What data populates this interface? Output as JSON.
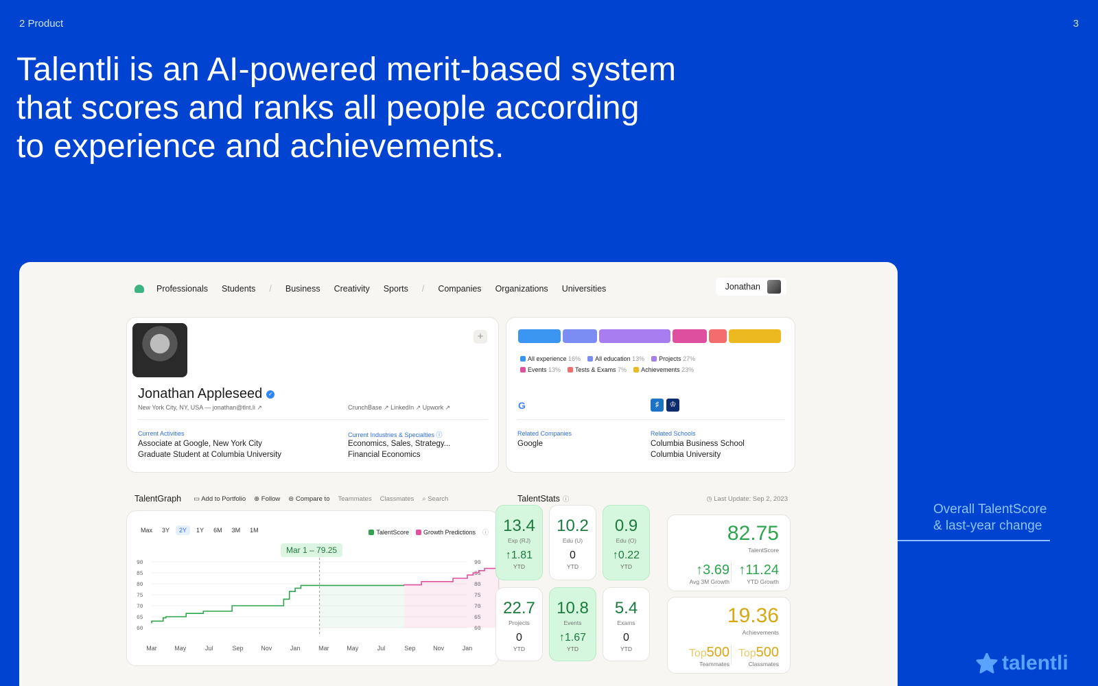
{
  "slide": {
    "section": "2 Product",
    "page_number": "3",
    "headline_lines": [
      "Talentli is an AI-powered merit-based system",
      "that scores and ranks all people according",
      "to experience and achievements."
    ],
    "annotation_lines": [
      "Overall TalentScore",
      "& last-year change"
    ],
    "logo_text": "talentli"
  },
  "nav": {
    "items_group1": [
      "Professionals",
      "Students"
    ],
    "items_group2": [
      "Business",
      "Creativity",
      "Sports"
    ],
    "items_group3": [
      "Companies",
      "Organizations",
      "Universities"
    ],
    "separator": "/",
    "user_name": "Jonathan"
  },
  "profile": {
    "name": "Jonathan Appleseed",
    "location": "New York City, NY, USA  —  jonathan@tlnt.li ↗",
    "links": "CrunchBase ↗  LinkedIn ↗  Upwork ↗",
    "plus": "+",
    "activities_label": "Current Activities",
    "activities": [
      "Associate at Google, New York City",
      "Graduate Student at Columbia University"
    ],
    "industries_label": "Current Industries & Specialties ⓘ",
    "industries": [
      "Economics, Sales, Strategy...",
      "Financial Economics"
    ]
  },
  "distribution": {
    "segments": [
      {
        "label": "All experience",
        "pct": "16%",
        "color": "#3a96f0",
        "share": 16
      },
      {
        "label": "All education",
        "pct": "13%",
        "color": "#7b8cf2",
        "share": 13
      },
      {
        "label": "Projects",
        "pct": "27%",
        "color": "#a77df0",
        "share": 27
      },
      {
        "label": "Events",
        "pct": "13%",
        "color": "#df4fa0",
        "share": 13
      },
      {
        "label": "Tests & Exams",
        "pct": "7%",
        "color": "#f46d6d",
        "share": 7
      },
      {
        "label": "Achievements",
        "pct": "23%",
        "color": "#ecb920",
        "share": 23
      }
    ],
    "companies_label": "Related Companies",
    "companies": [
      "Google"
    ],
    "schools_label": "Related Schools",
    "schools": [
      "Columbia Business School",
      "Columbia University"
    ]
  },
  "graph_toolbar": {
    "title": "TalentGraph",
    "add_to_portfolio": "Add to Portfolio",
    "follow": "Follow",
    "compare_to": "Compare to",
    "teammates": "Teammates",
    "classmates": "Classmates",
    "search": "Search"
  },
  "stats_toolbar": {
    "title": "TalentStats",
    "last_update": "Last Update: Sep 2, 2023"
  },
  "graph": {
    "ranges": [
      "Max",
      "3Y",
      "2Y",
      "1Y",
      "6M",
      "3M",
      "1M"
    ],
    "active_range": "2Y",
    "legend_talentscore": "TalentScore",
    "legend_growth": "Growth Predictions",
    "tooltip": "Mar 1 – 79.25"
  },
  "chart_data": {
    "type": "line",
    "x_labels": [
      "Mar",
      "May",
      "Jul",
      "Sep",
      "Nov",
      "Jan",
      "Mar",
      "May",
      "Jul",
      "Sep",
      "Nov",
      "Jan"
    ],
    "ylim": [
      60,
      90
    ],
    "y_ticks": [
      90,
      85,
      80,
      75,
      70,
      65,
      60
    ],
    "series": [
      {
        "name": "TalentScore",
        "color": "#2ea44f",
        "points": [
          [
            0,
            62
          ],
          [
            0.4,
            63
          ],
          [
            0.5,
            64.5
          ],
          [
            1.2,
            65
          ],
          [
            1.8,
            66.5
          ],
          [
            2.8,
            67.5
          ],
          [
            4.6,
            70
          ],
          [
            4.8,
            73
          ],
          [
            5.0,
            76.5
          ],
          [
            5.2,
            78
          ],
          [
            5.8,
            79.25
          ],
          [
            8.8,
            79.25
          ]
        ]
      },
      {
        "name": "Growth Predictions",
        "color": "#e0529c",
        "points": [
          [
            8.8,
            79.25
          ],
          [
            9.4,
            79.5
          ],
          [
            10.5,
            81
          ],
          [
            11.0,
            82.5
          ],
          [
            11.2,
            84
          ],
          [
            11.4,
            85
          ],
          [
            11.6,
            86
          ],
          [
            11.8,
            87
          ],
          [
            12.3,
            87
          ]
        ]
      }
    ],
    "marker_x": 5.85
  },
  "stats": {
    "cards": [
      {
        "value": "13.4",
        "label": "Exp (RJ)",
        "delta": "↑1.81",
        "sub": "YTD",
        "highlight": true
      },
      {
        "value": "10.2",
        "label": "Edu (U)",
        "delta": "0",
        "sub": "YTD",
        "highlight": false
      },
      {
        "value": "0.9",
        "label": "Edu (O)",
        "delta": "↑0.22",
        "sub": "YTD",
        "highlight": true
      },
      {
        "value": "22.7",
        "label": "Projects",
        "delta": "0",
        "sub": "YTD",
        "highlight": false
      },
      {
        "value": "10.8",
        "label": "Events",
        "delta": "↑1.67",
        "sub": "YTD",
        "highlight": true
      },
      {
        "value": "5.4",
        "label": "Exams",
        "delta": "0",
        "sub": "YTD",
        "highlight": false
      }
    ],
    "talentscore": {
      "value": "82.75",
      "label": "TalentScore",
      "growth3m": "↑3.69",
      "growth3m_label": "Avg 3M Growth",
      "ytd": "↑11.24",
      "ytd_label": "YTD Growth"
    },
    "achievements": {
      "value": "19.36",
      "label": "Achievements",
      "top_prefix": "Top",
      "teammates_rank": "500",
      "teammates_label": "Teammates",
      "classmates_rank": "500",
      "classmates_label": "Classmates"
    }
  }
}
